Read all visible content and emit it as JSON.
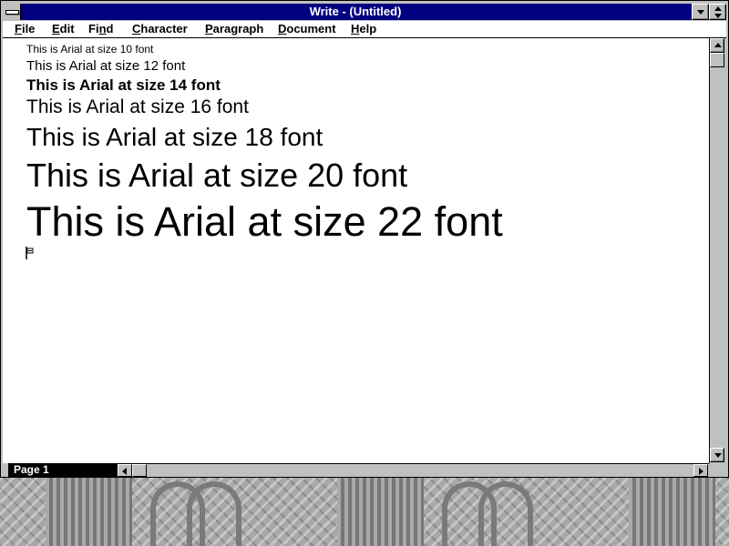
{
  "window": {
    "title": "Write - (Untitled)"
  },
  "menu": {
    "items": [
      {
        "accel": "F",
        "rest": "ile"
      },
      {
        "accel": "E",
        "rest": "dit"
      },
      {
        "pre": "Fi",
        "accel": "n",
        "rest": "d"
      },
      {
        "accel": "C",
        "rest": "haracter"
      },
      {
        "accel": "P",
        "rest": "aragraph"
      },
      {
        "accel": "D",
        "rest": "ocument"
      },
      {
        "accel": "H",
        "rest": "elp"
      }
    ]
  },
  "document": {
    "lines": [
      {
        "text": "This is Arial at size 10 font",
        "size_pt": 10
      },
      {
        "text": "This is Arial at size 12 font",
        "size_pt": 12
      },
      {
        "text": "This is Arial at size 14 font",
        "size_pt": 14
      },
      {
        "text": "This is Arial at size 16 font",
        "size_pt": 16
      },
      {
        "text": "This is Arial at size 18 font",
        "size_pt": 18
      },
      {
        "text": "This is Arial at size 20 font",
        "size_pt": 20
      },
      {
        "text": "This is Arial at size 22 font",
        "size_pt": 22
      }
    ]
  },
  "status": {
    "page_label": "Page 1"
  },
  "icons": {
    "system_menu": "system-menu-icon",
    "minimize": "minimize-icon",
    "maximize": "maximize-icon",
    "scroll_up": "arrow-up-icon",
    "scroll_down": "arrow-down-icon",
    "scroll_left": "arrow-left-icon",
    "scroll_right": "arrow-right-icon",
    "end_mark": "end-of-document-mark-icon"
  },
  "colors": {
    "titlebar": "#000080",
    "chrome": "#c0c0c0",
    "page_box": "#000000"
  }
}
